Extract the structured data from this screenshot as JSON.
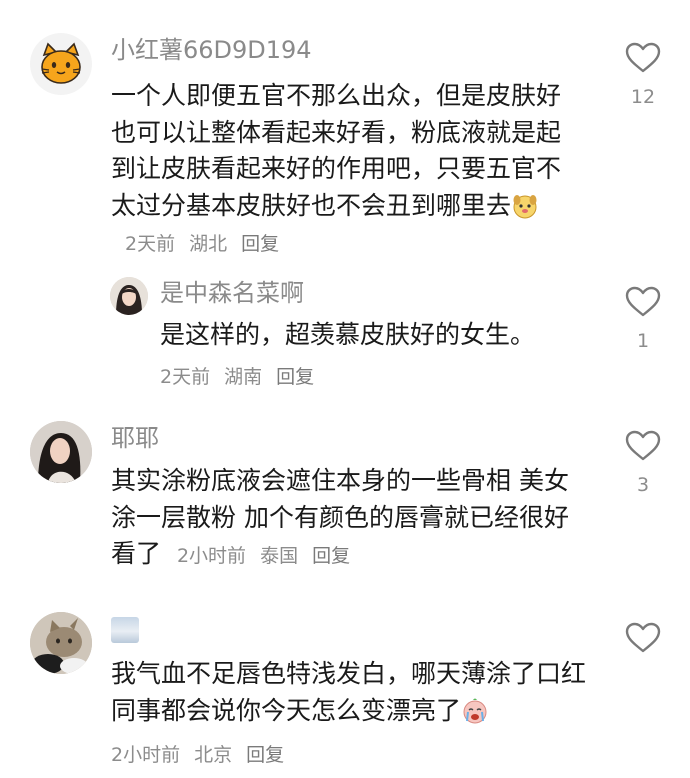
{
  "comments": [
    {
      "username": "小红薯66D9D194",
      "text": "一个人即便五官不那么出众，但是皮肤好也可以让整体看起来好看，粉底液就是起到让皮肤看起来好的作用吧，只要五官不太过分基本皮肤好也不会丑到哪里去",
      "emoji": "puppy-face-sticker",
      "time": "2天前",
      "location": "湖北",
      "reply_label": "回复",
      "likes": "12",
      "avatar": "orange-cat-icon",
      "replies": [
        {
          "username": "是中森名菜啊",
          "text": "是这样的，超羡慕皮肤好的女生。",
          "time": "2天前",
          "location": "湖南",
          "reply_label": "回复",
          "likes": "1",
          "avatar": "girl-portrait-avatar"
        }
      ]
    },
    {
      "username": "耶耶",
      "text": "其实涂粉底液会遮住本身的一些骨相 美女涂一层散粉 加个有颜色的唇膏就已经很好看了",
      "time": "2小时前",
      "location": "泰国",
      "reply_label": "回复",
      "likes": "3",
      "avatar": "woman-photo-avatar"
    },
    {
      "username": "",
      "username_icon": "cloud-image-icon",
      "text": "我气血不足唇色特浅发白，哪天薄涂了口红同事都会说你今天怎么变漂亮了",
      "emoji": "crying-sticker",
      "time": "2小时前",
      "location": "北京",
      "reply_label": "回复",
      "likes": "",
      "avatar": "cat-photo-avatar"
    }
  ]
}
